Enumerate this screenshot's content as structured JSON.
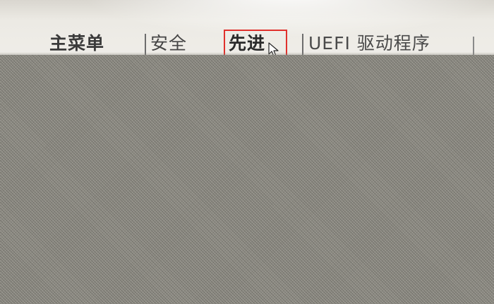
{
  "tabs": [
    {
      "id": "main",
      "label": "主菜单",
      "selected": false
    },
    {
      "id": "security",
      "label": "安全",
      "selected": false
    },
    {
      "id": "advanced",
      "label": "先进",
      "selected": true
    },
    {
      "id": "uefi",
      "label": "UEFI 驱动程序",
      "selected": false
    }
  ],
  "colors": {
    "selection_border": "#e0302c",
    "tab_text": "#3a3a3a",
    "background": "#ecebe6",
    "obscured_area": "#8e8c84"
  },
  "icons": {
    "pointer": "mouse-pointer-icon"
  }
}
